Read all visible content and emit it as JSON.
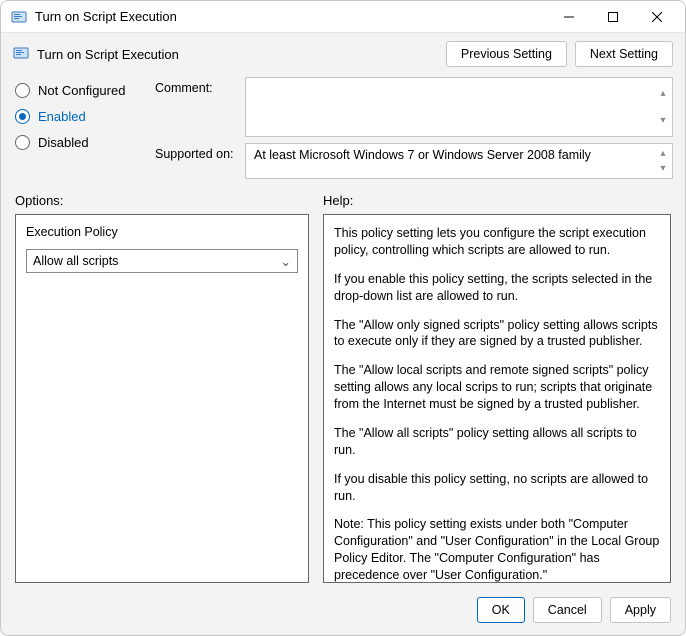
{
  "window": {
    "title": "Turn on Script Execution"
  },
  "header": {
    "title": "Turn on Script Execution",
    "prev_btn": "Previous Setting",
    "next_btn": "Next Setting"
  },
  "state": {
    "not_configured": "Not Configured",
    "enabled": "Enabled",
    "disabled": "Disabled",
    "selected": "enabled"
  },
  "comment": {
    "label": "Comment:",
    "value": ""
  },
  "supported": {
    "label": "Supported on:",
    "value": "At least Microsoft Windows 7 or Windows Server 2008 family"
  },
  "labels": {
    "options": "Options:",
    "help": "Help:"
  },
  "options": {
    "execution_policy_label": "Execution Policy",
    "execution_policy_value": "Allow all scripts"
  },
  "help": {
    "p1": "This policy setting lets you configure the script execution policy, controlling which scripts are allowed to run.",
    "p2": "If you enable this policy setting, the scripts selected in the drop-down list are allowed to run.",
    "p3": "The \"Allow only signed scripts\" policy setting allows scripts to execute only if they are signed by a trusted publisher.",
    "p4": "The \"Allow local scripts and remote signed scripts\" policy setting allows any local scrips to run; scripts that originate from the Internet must be signed by a trusted publisher.",
    "p5": "The \"Allow all scripts\" policy setting allows all scripts to run.",
    "p6": "If you disable this policy setting, no scripts are allowed to run.",
    "p7": "Note: This policy setting exists under both \"Computer Configuration\" and \"User Configuration\" in the Local Group Policy Editor. The \"Computer Configuration\" has precedence over \"User Configuration.\""
  },
  "footer": {
    "ok": "OK",
    "cancel": "Cancel",
    "apply": "Apply"
  }
}
